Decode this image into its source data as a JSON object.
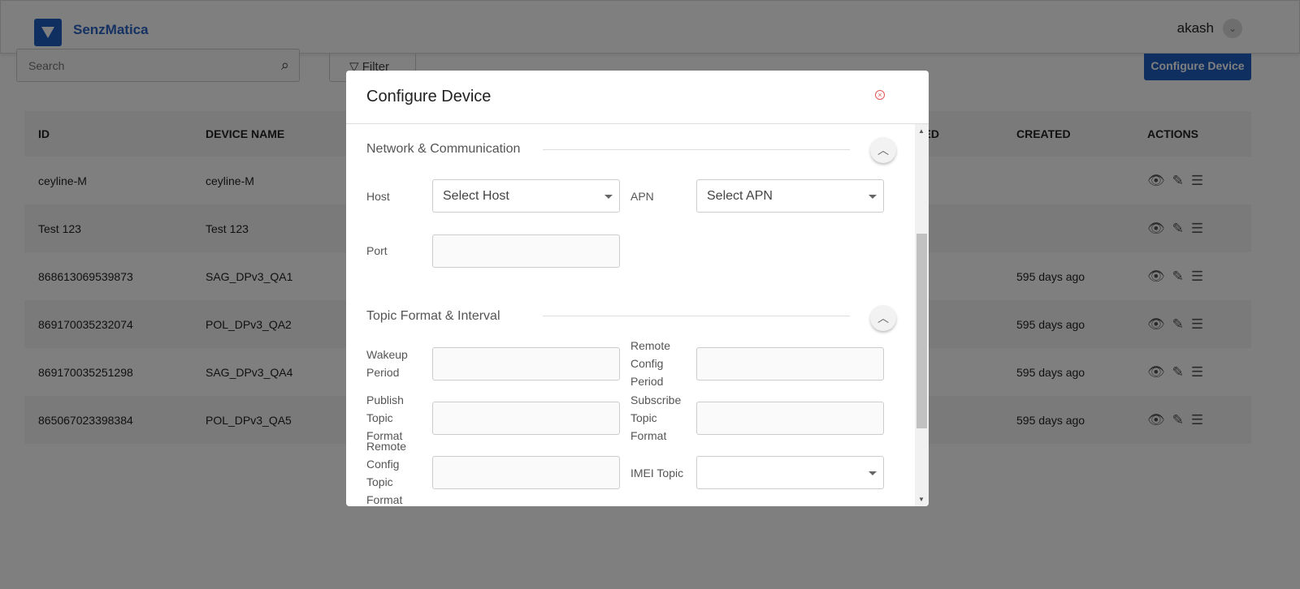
{
  "header": {
    "brand": "SenzMatica",
    "user": "akash"
  },
  "toolbar": {
    "search_placeholder": "Search",
    "filter_label": "Filter",
    "configure_label": "Configure Device"
  },
  "table": {
    "columns": [
      "ID",
      "DEVICE NAME",
      "TED",
      "CREATED",
      "ACTIONS"
    ],
    "rows": [
      {
        "id": "ceyline-M",
        "name": "ceyline-M",
        "created": ""
      },
      {
        "id": "Test 123",
        "name": "Test 123",
        "created": ""
      },
      {
        "id": "868613069539873",
        "name": "SAG_DPv3_QA1",
        "created": "595 days ago"
      },
      {
        "id": "869170035232074",
        "name": "POL_DPv3_QA2",
        "created": "595 days ago"
      },
      {
        "id": "869170035251298",
        "name": "SAG_DPv3_QA4",
        "created": "595 days ago"
      },
      {
        "id": "865067023398384",
        "name": "POL_DPv3_QA5",
        "created": "595 days ago"
      }
    ]
  },
  "modal": {
    "title": "Configure Device",
    "sections": [
      "Network & Communication",
      "Topic Format & Interval"
    ],
    "host_label": "Host",
    "host_value": "Select Host",
    "apn_label": "APN",
    "apn_value": "Select APN",
    "port_label": "Port",
    "wakeup_label": "Wakeup Period",
    "remote_config_period_label": "Remote Config Period",
    "publish_label": "Publish Topic Format",
    "subscribe_label": "Subscribe Topic Format",
    "remote_config_topic_label": "Remote Config Topic Format",
    "imei_label": "IMEI Topic"
  }
}
